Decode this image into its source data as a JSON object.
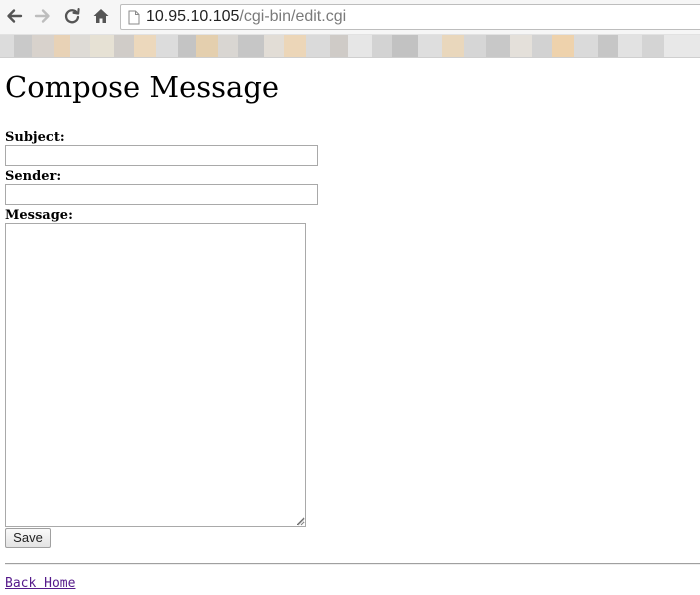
{
  "browser": {
    "url_host": "10.95.10.105",
    "url_path": "/cgi-bin/edit.cgi",
    "icons": [
      "back-arrow-icon",
      "forward-arrow-icon",
      "reload-icon",
      "home-icon",
      "page-icon"
    ],
    "bookmarks_blurred": true
  },
  "page": {
    "title": "Compose Message"
  },
  "form": {
    "subject_label": "Subject:",
    "subject_value": "",
    "sender_label": "Sender:",
    "sender_value": "",
    "message_label": "Message:",
    "message_value": "",
    "save_label": "Save"
  },
  "footer": {
    "back_home_label": "Back Home"
  },
  "colors": {
    "link": "#551a8b",
    "text": "#000000",
    "field_border": "#a9a9a9"
  }
}
